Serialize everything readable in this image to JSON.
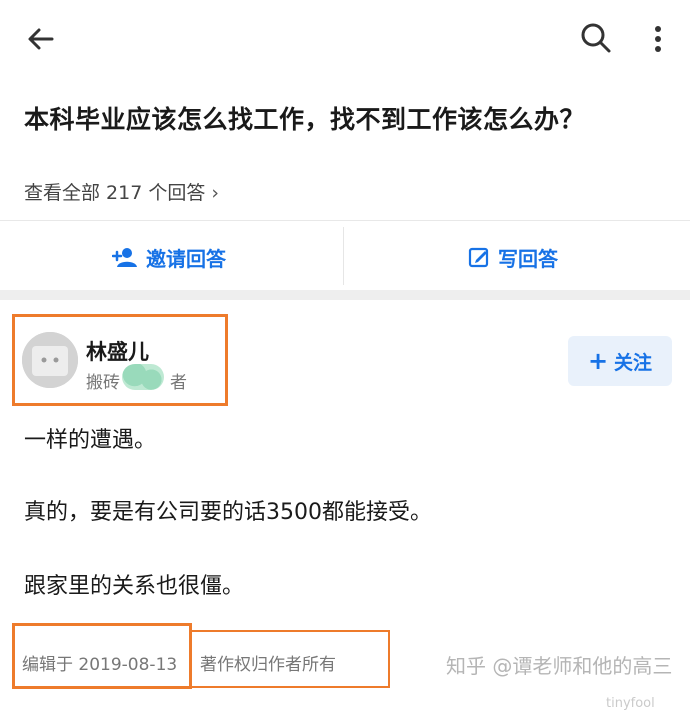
{
  "header": {
    "back_icon": "arrow-left-icon",
    "search_icon": "search-icon",
    "more_icon": "more-vertical-icon"
  },
  "question": {
    "title": "本科毕业应该怎么找工作，找不到工作该怎么办？",
    "all_answers": "查看全部 217 个回答"
  },
  "actions": {
    "invite_label": "邀请回答",
    "write_label": "写回答"
  },
  "answer": {
    "author_name": "林盛儿",
    "author_tag": "搬砖",
    "author_tag_end": "者",
    "follow_label": "关注",
    "paragraphs": [
      "一样的遭遇。",
      "真的，要是有公司要的话3500都能接受。",
      "跟家里的关系也很僵。"
    ],
    "edit_date": "编辑于 2019-08-13",
    "copyright": "著作权归作者所有"
  },
  "watermark": {
    "main": "知乎 @谭老师和他的高三",
    "sub": "tinyfool"
  },
  "colors": {
    "accent": "#1772e6",
    "highlight": "#ee7b2b"
  }
}
